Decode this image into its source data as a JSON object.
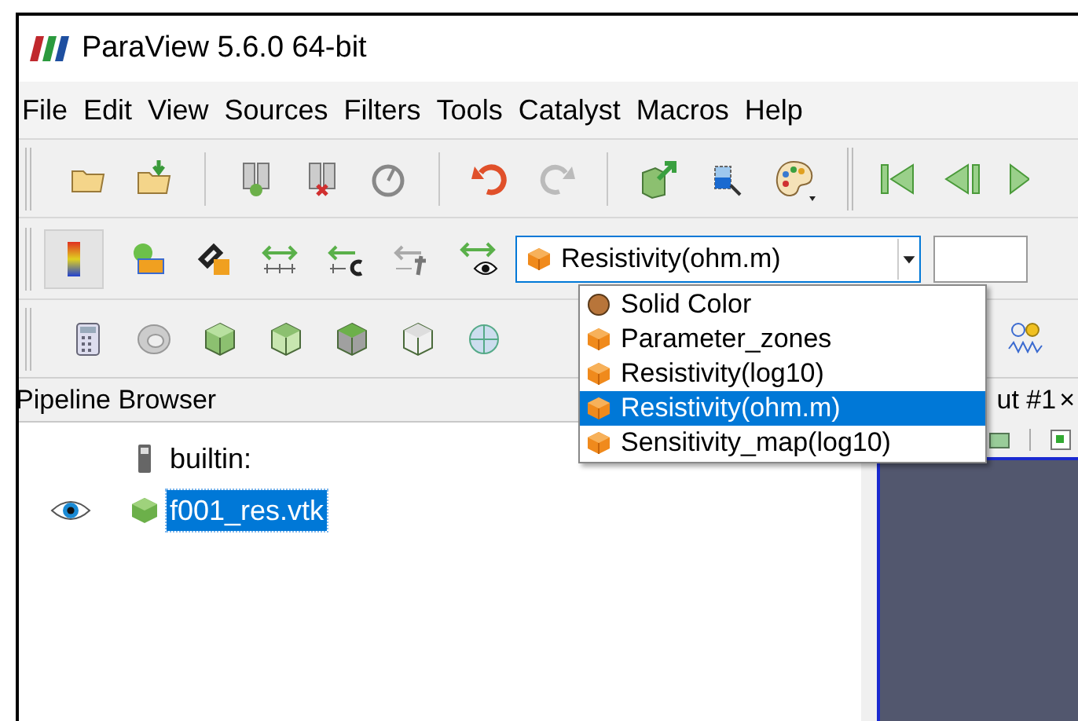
{
  "window": {
    "title": "ParaView 5.6.0 64-bit"
  },
  "menu": [
    "File",
    "Edit",
    "View",
    "Sources",
    "Filters",
    "Tools",
    "Catalyst",
    "Macros",
    "Help"
  ],
  "color_by": {
    "value": "Resistivity(ohm.m)",
    "expanded": true,
    "options": [
      {
        "label": "Solid Color",
        "kind": "solid",
        "selected": false
      },
      {
        "label": "Parameter_zones",
        "kind": "cell",
        "selected": false
      },
      {
        "label": "Resistivity(log10)",
        "kind": "cell",
        "selected": false
      },
      {
        "label": "Resistivity(ohm.m)",
        "kind": "cell",
        "selected": true
      },
      {
        "label": "Sensitivity_map(log10)",
        "kind": "cell",
        "selected": false
      }
    ]
  },
  "pipeline_browser": {
    "title": "Pipeline Browser",
    "items": [
      {
        "label": "builtin:",
        "kind": "server",
        "selected": false,
        "children": [
          {
            "label": "f001_res.vtk",
            "kind": "dataset",
            "visible": true,
            "selected": true
          }
        ]
      }
    ]
  },
  "view_tab": {
    "label": "ut #1",
    "close": "×"
  }
}
